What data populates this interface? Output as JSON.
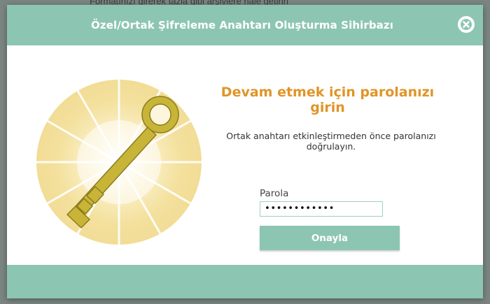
{
  "background": {
    "partial_text": "Formatınızı girerek tazla gibi arşivlere nale getirin"
  },
  "dialog": {
    "title": "Özel/Ortak Şifreleme Anahtarı Oluşturma Sihirbazı",
    "close_icon": "close-x-icon",
    "heading": "Devam etmek için parolanızı girin",
    "description": "Ortak anahtarı etkinleştirmeden önce parolanızı doğrulayın.",
    "password_label": "Parola",
    "password_value": "••••••••••••",
    "confirm_label": "Onayla",
    "illustration_icon": "key-icon"
  },
  "colors": {
    "accent": "#8dc5b3",
    "heading": "#e09426",
    "key_gold": "#c8b437",
    "glow": "#f6e6a7"
  }
}
